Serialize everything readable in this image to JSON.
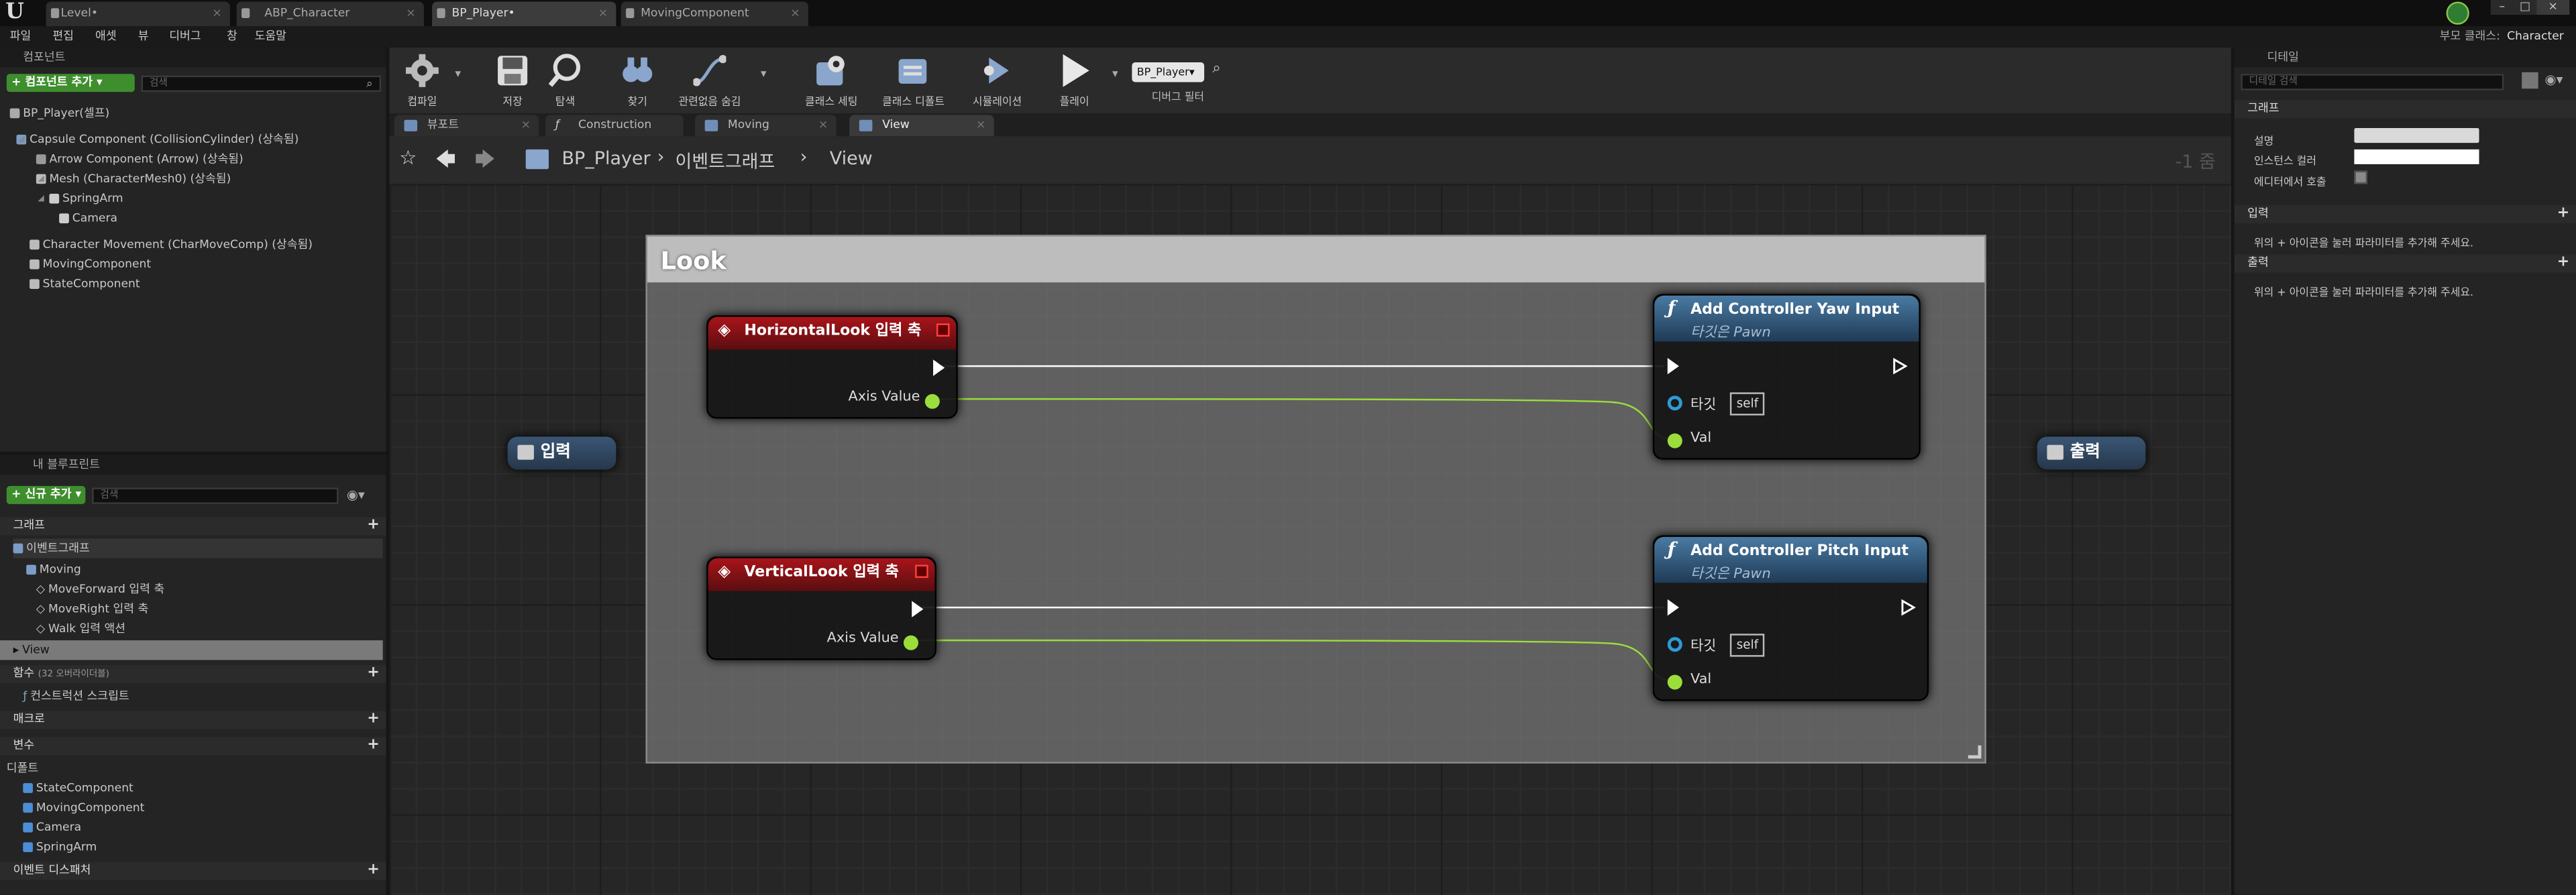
{
  "window": {
    "tabs": [
      {
        "label": "Level•"
      },
      {
        "label": "ABP_Character"
      },
      {
        "label": "BP_Player•"
      },
      {
        "label": "MovingComponent"
      }
    ],
    "parent_class_label": "부모 클래스:",
    "parent_class_value": "Character"
  },
  "menu": [
    "파일",
    "편집",
    "애셋",
    "뷰",
    "디버그",
    "창",
    "도움말"
  ],
  "components_panel": {
    "title": "컴포넌트",
    "add_button": "+ 컴포넌트 추가 ▾",
    "search_placeholder": "검색",
    "root": "BP_Player(셀프)",
    "items": [
      {
        "label": "Capsule Component (CollisionCylinder) (상속됨)"
      },
      {
        "label": "Arrow Component (Arrow) (상속됨)"
      },
      {
        "label": "Mesh (CharacterMesh0) (상속됨)"
      },
      {
        "label": "SpringArm"
      },
      {
        "label": "Camera"
      },
      {
        "label": "Character Movement (CharMoveComp) (상속됨)"
      },
      {
        "label": "MovingComponent"
      },
      {
        "label": "StateComponent"
      }
    ]
  },
  "my_blueprint": {
    "title": "내 블루프린트",
    "add_button": "+ 신규 추가 ▾",
    "search_placeholder": "검색",
    "graphs_header": "그래프",
    "event_graph": "이벤트그래프",
    "moving": "Moving",
    "move_forward": "MoveForward 입력 축",
    "move_right": "MoveRight 입력 축",
    "walk": "Walk 입력 액션",
    "view": "View",
    "functions_header": "함수",
    "functions_overridable": "(32 오버라이더블)",
    "construction_script": "컨스트럭션 스크립트",
    "macros_header": "매크로",
    "variables_header": "변수",
    "components_header": "디폴트",
    "variables": [
      "StateComponent",
      "MovingComponent",
      "Camera",
      "SpringArm"
    ],
    "dispatchers_header": "이벤트 디스패처"
  },
  "toolbar": {
    "compile": "컴파일",
    "save": "저장",
    "browse": "탐색",
    "find": "찾기",
    "hide_unrelated": "관련없음 숨김",
    "class_settings": "클래스 세팅",
    "class_defaults": "클래스 디폴트",
    "simulation": "시뮬레이션",
    "play": "플레이",
    "debug_object": "BP_Player▾",
    "debug_filter": "디버그 필터"
  },
  "graph_tabs": [
    {
      "label": "뷰포트"
    },
    {
      "label": "Construction Script"
    },
    {
      "label": "Moving"
    },
    {
      "label": "View"
    }
  ],
  "breadcrumb": {
    "blueprint": "BP_Player",
    "graph": "이벤트그래프",
    "subgraph": "View",
    "zoom": "-1 줌"
  },
  "graph": {
    "comment_title": "Look",
    "input_tunnel": "입력",
    "output_tunnel": "출력",
    "horizontal_event": "HorizontalLook 입력 축",
    "vertical_event": "VerticalLook 입력 축",
    "axis_value": "Axis Value",
    "yaw_title": "Add Controller Yaw Input",
    "pitch_title": "Add Controller Pitch Input",
    "target_is": "타깃은",
    "pawn": "Pawn",
    "target_pin": "타깃",
    "self_default": "self",
    "val_pin": "Val"
  },
  "details": {
    "title": "디테일",
    "search_placeholder": "디테일 검색",
    "graph_section": "그래프",
    "description_label": "설명",
    "instance_color_label": "인스턴스 컬러",
    "call_in_editor_label": "에디터에서 호출",
    "inputs_section": "입력",
    "inputs_hint": "위의 + 아이콘을 눌러 파라미터를 추가해 주세요.",
    "outputs_section": "출력",
    "outputs_hint": "위의 + 아이콘을 눌러 파라미터를 추가해 주세요."
  },
  "colors": {
    "exec_wire": "#ffffff",
    "float_wire": "#9bde3c",
    "event_header": "#a8141a",
    "function_header": "#4a7ba3"
  }
}
